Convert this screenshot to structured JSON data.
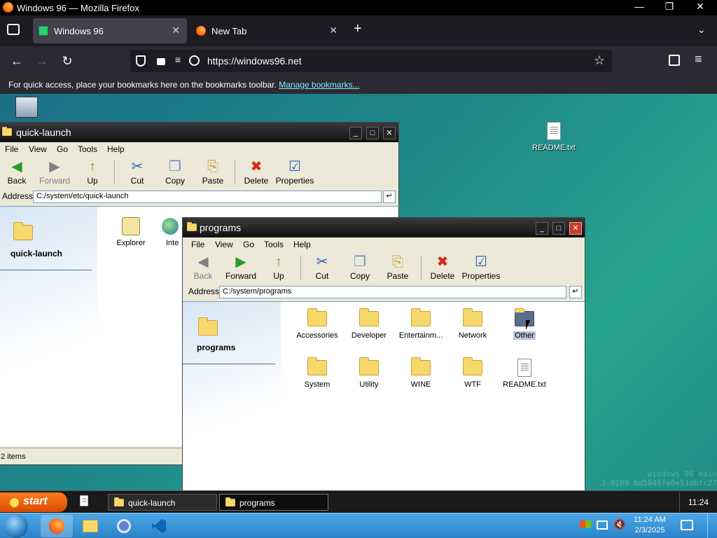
{
  "browser": {
    "window_title": "Windows 96 — Mozilla Firefox",
    "tabs": [
      {
        "label": "Windows 96",
        "active": true
      },
      {
        "label": "New Tab",
        "active": false
      }
    ],
    "url": "https://windows96.net",
    "bookmarks_message": "For quick access, place your bookmarks here on the bookmarks toolbar.",
    "bookmarks_link": "Manage bookmarks..."
  },
  "desktop": {
    "readme_label": "README.txt",
    "watermark_line1": "windows 96 main",
    "watermark_line2": "3-0109 bd5049fe0e51dbfc27"
  },
  "explorer_menu": [
    "File",
    "View",
    "Go",
    "Tools",
    "Help"
  ],
  "explorer_tools": [
    "Back",
    "Forward",
    "Up",
    "Cut",
    "Copy",
    "Paste",
    "Delete",
    "Properties"
  ],
  "quick_launch": {
    "title": "quick-launch",
    "address_label": "Address",
    "address": "C:/system/etc/quick-launch",
    "side_title": "quick-launch",
    "items": [
      "Explorer",
      "Inte"
    ],
    "status": "2 items"
  },
  "programs": {
    "title": "programs",
    "address_label": "Address",
    "address": "C:/system/programs",
    "side_title": "programs",
    "items": [
      "Accessories",
      "Developer",
      "Entertainm...",
      "Network",
      "Other",
      "System",
      "Utility",
      "WINE",
      "WTF",
      "README.txt"
    ]
  },
  "w96_taskbar": {
    "start_label": "start",
    "tasks": [
      "quick-launch",
      "programs"
    ],
    "clock": "11:24"
  },
  "win7_taskbar": {
    "time": "11:24 AM",
    "date": "2/3/2025"
  },
  "colors": {
    "accent_orange": "#e8600a",
    "desktop_teal": "#1f8a8a",
    "firefox_dark": "#2b2a33"
  }
}
